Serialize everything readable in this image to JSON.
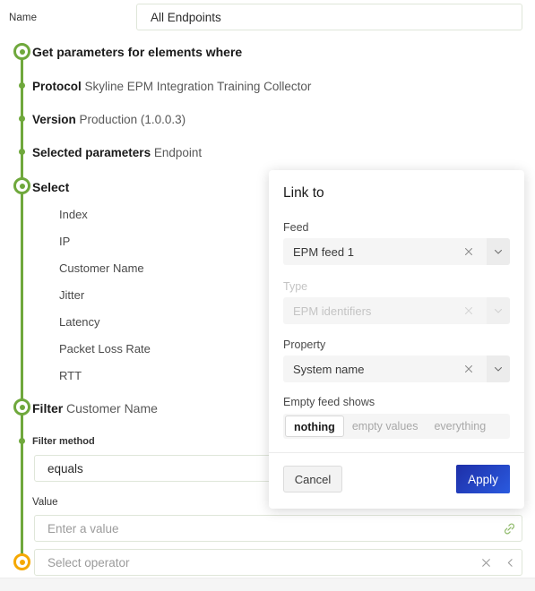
{
  "name_field": {
    "label": "Name",
    "value": "All Endpoints"
  },
  "timeline": {
    "steps": [
      {
        "title": "Get parameters for elements where",
        "value": ""
      },
      {
        "title": "Protocol",
        "value": "Skyline EPM Integration Training Collector"
      },
      {
        "title": "Version",
        "value": "Production (1.0.0.3)"
      },
      {
        "title": "Selected parameters",
        "value": "Endpoint"
      },
      {
        "title": "Select",
        "value": ""
      },
      {
        "title": "Filter",
        "value": "Customer Name"
      }
    ],
    "selected_parameters": [
      "Index",
      "IP",
      "Customer Name",
      "Jitter",
      "Latency",
      "Packet Loss Rate",
      "RTT"
    ]
  },
  "filter_section": {
    "method_label": "Filter method",
    "method_value": "equals",
    "value_label": "Value",
    "value_placeholder": "Enter a value",
    "operator_placeholder": "Select operator"
  },
  "dialog": {
    "title": "Link to",
    "feed": {
      "label": "Feed",
      "value": "EPM feed 1"
    },
    "type": {
      "label": "Type",
      "value": "EPM identifiers"
    },
    "property": {
      "label": "Property",
      "value": "System name"
    },
    "empty_feed": {
      "label": "Empty feed shows",
      "options": [
        "nothing",
        "empty values",
        "everything"
      ],
      "selected": "nothing"
    },
    "cancel_label": "Cancel",
    "apply_label": "Apply"
  },
  "colors": {
    "accent_green": "#6fa83c",
    "accent_orange": "#f5a800",
    "apply_blue": "#2a5adf"
  }
}
